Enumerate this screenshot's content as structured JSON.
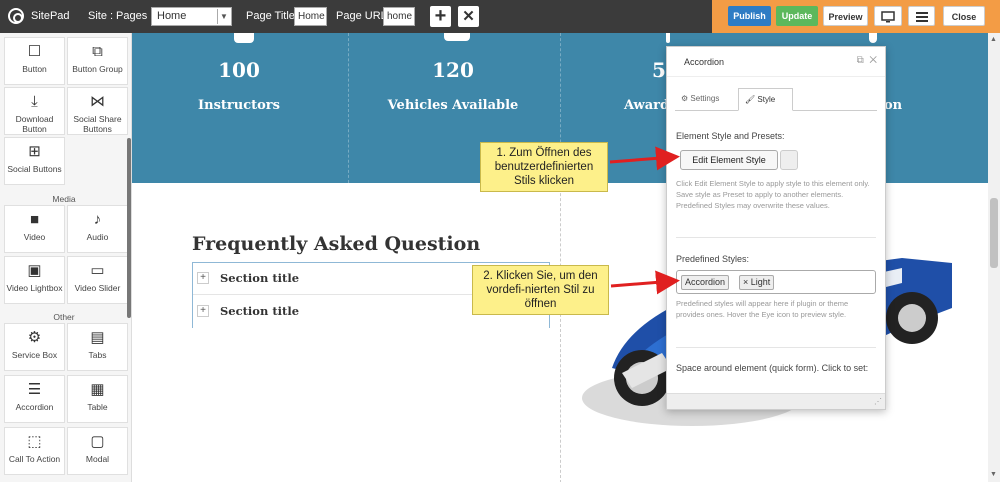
{
  "topbar": {
    "app_name": "SitePad",
    "site_label": "Site :",
    "pages_label": "Pages :",
    "pages_value": "Home",
    "page_title_label": "Page Title:",
    "page_title_value": "Home",
    "page_url_label": "Page URL:",
    "page_url_value": "home",
    "add_icon": "+",
    "close_icon": "✕"
  },
  "actions": {
    "publish": "Publish",
    "update": "Update",
    "preview": "Preview",
    "close": "Close",
    "colors": {
      "bar": "#f39c45",
      "publish": "#2e7cc4",
      "update": "#5cb85c"
    }
  },
  "sidebar": {
    "widgets_top": [
      {
        "label": "Button",
        "icon": "button-icon"
      },
      {
        "label": "Button Group",
        "icon": "button-group-icon"
      },
      {
        "label": "Download Button",
        "icon": "download-icon"
      },
      {
        "label": "Social Share Buttons",
        "icon": "share-icon"
      },
      {
        "label": "Social Buttons",
        "icon": "social-buttons-icon"
      }
    ],
    "section_media": "Media",
    "widgets_media": [
      {
        "label": "Video",
        "icon": "video-icon"
      },
      {
        "label": "Audio",
        "icon": "audio-icon"
      },
      {
        "label": "Video Lightbox",
        "icon": "video-lightbox-icon"
      },
      {
        "label": "Video Slider",
        "icon": "video-slider-icon"
      }
    ],
    "section_other": "Other",
    "widgets_other": [
      {
        "label": "Service Box",
        "icon": "gear-icon"
      },
      {
        "label": "Tabs",
        "icon": "tabs-icon"
      },
      {
        "label": "Accordion",
        "icon": "accordion-icon"
      },
      {
        "label": "Table",
        "icon": "table-icon"
      },
      {
        "label": "Call To Action",
        "icon": "cursor-icon"
      },
      {
        "label": "Modal",
        "icon": "modal-icon"
      }
    ]
  },
  "stats": [
    {
      "number": "100",
      "label": "Instructors"
    },
    {
      "number": "120",
      "label": "Vehicles Available"
    },
    {
      "number": "5",
      "label": "Award"
    },
    {
      "number": "",
      "label": "on"
    }
  ],
  "faq": {
    "title": "Frequently Asked Question",
    "sections": [
      "Section title",
      "Section title"
    ]
  },
  "panel": {
    "title": "Accordion",
    "tab_settings": "Settings",
    "tab_style": "Style",
    "element_style_title": "Element Style and Presets:",
    "edit_button": "Edit Element Style",
    "help_edit": "Click Edit Element Style to apply style to this element only. Save style as Preset to apply to another elements. Predefined Styles may overwrite these values.",
    "predefined_title": "Predefined Styles:",
    "tags": [
      "Accordion",
      "× Light"
    ],
    "help_predefined": "Predefined styles will appear here if plugin or theme provides ones. Hover the Eye icon to preview style.",
    "space_title": "Space around element (quick form). Click to set:"
  },
  "callouts": {
    "one": "1. Zum Öffnen des benutzerdefinierten Stils klicken",
    "two": "2. Klicken Sie, um den vordefi-nierten Stil zu öffnen",
    "color": "#fdf08a",
    "arrow_color": "#e02020"
  }
}
